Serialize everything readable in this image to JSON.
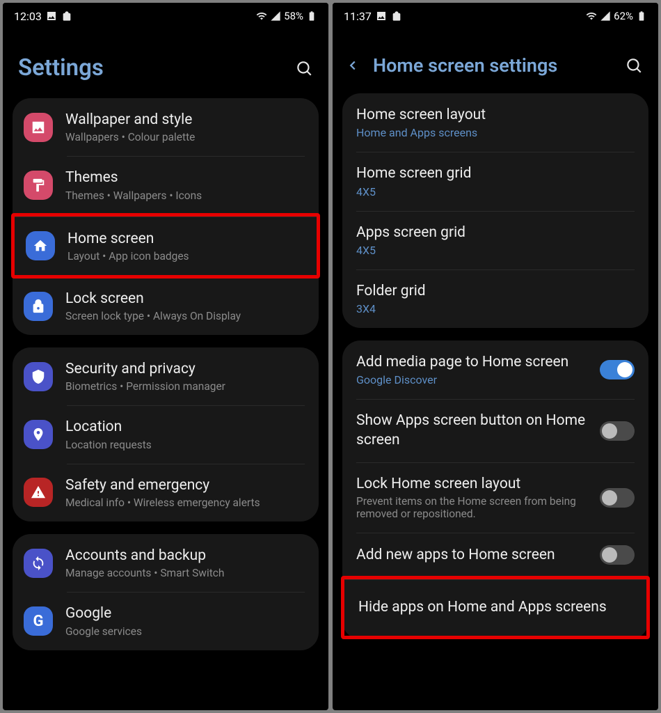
{
  "left": {
    "status": {
      "time": "12:03",
      "battery": "58%"
    },
    "title": "Settings",
    "group1": {
      "wallpaper": {
        "title": "Wallpaper and style",
        "sub": "Wallpapers  •  Colour palette",
        "color": "#d44a6a"
      },
      "themes": {
        "title": "Themes",
        "sub": "Themes  •  Wallpapers  •  Icons",
        "color": "#d44a6a"
      },
      "home": {
        "title": "Home screen",
        "sub": "Layout  •  App icon badges",
        "color": "#3a6cd8"
      },
      "lock": {
        "title": "Lock screen",
        "sub": "Screen lock type  •  Always On Display",
        "color": "#3a6cd8"
      }
    },
    "group2": {
      "security": {
        "title": "Security and privacy",
        "sub": "Biometrics  •  Permission manager",
        "color": "#4a52c8"
      },
      "location": {
        "title": "Location",
        "sub": "Location requests",
        "color": "#4a52c8"
      },
      "safety": {
        "title": "Safety and emergency",
        "sub": "Medical info  •  Wireless emergency alerts",
        "color": "#b82525"
      }
    },
    "group3": {
      "accounts": {
        "title": "Accounts and backup",
        "sub": "Manage accounts  •  Smart Switch",
        "color": "#4a52c8"
      },
      "google": {
        "title": "Google",
        "sub": "Google services",
        "color": "#3a6cd8"
      }
    }
  },
  "right": {
    "status": {
      "time": "11:37",
      "battery": "62%"
    },
    "title": "Home screen settings",
    "group1": {
      "layout": {
        "title": "Home screen layout",
        "sub": "Home and Apps screens"
      },
      "homegrid": {
        "title": "Home screen grid",
        "sub": "4X5"
      },
      "appsgrid": {
        "title": "Apps screen grid",
        "sub": "4X5"
      },
      "foldergrid": {
        "title": "Folder grid",
        "sub": "3X4"
      }
    },
    "group2": {
      "media": {
        "title": "Add media page to Home screen",
        "sub": "Google Discover"
      },
      "showapps": {
        "title": "Show Apps screen button on Home screen"
      },
      "locklayout": {
        "title": "Lock Home screen layout",
        "sub": "Prevent items on the Home screen from being removed or repositioned."
      },
      "addnew": {
        "title": "Add new apps to Home screen"
      },
      "hide": {
        "title": "Hide apps on Home and Apps screens"
      }
    }
  }
}
